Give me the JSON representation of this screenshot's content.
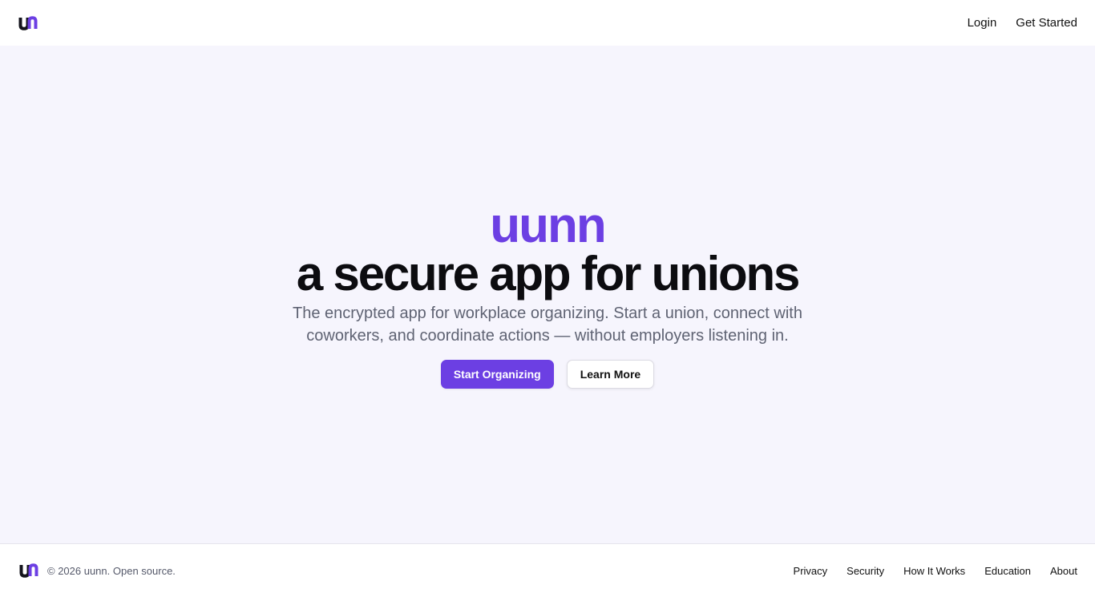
{
  "colors": {
    "accent": "#6c3fe3",
    "hero_background": "#f6f5fd",
    "headline": "#0c0c10",
    "subtitle": "#5f6373"
  },
  "header": {
    "logo_icon": "uunn-logo-icon",
    "nav": {
      "login_label": "Login",
      "get_started_label": "Get Started"
    }
  },
  "hero": {
    "brand": "uunn",
    "headline": "a secure app for unions",
    "subtitle_line1": "The encrypted app for workplace organizing. Start a union, connect with",
    "subtitle_line2": "coworkers, and coordinate actions — without employers listening in.",
    "primary_cta": "Start Organizing",
    "secondary_cta": "Learn More"
  },
  "footer": {
    "logo_icon": "uunn-logo-icon",
    "copyright": "© 2026 uunn. Open source.",
    "links": [
      {
        "label": "Privacy"
      },
      {
        "label": "Security"
      },
      {
        "label": "How It Works"
      },
      {
        "label": "Education"
      },
      {
        "label": "About"
      }
    ]
  }
}
